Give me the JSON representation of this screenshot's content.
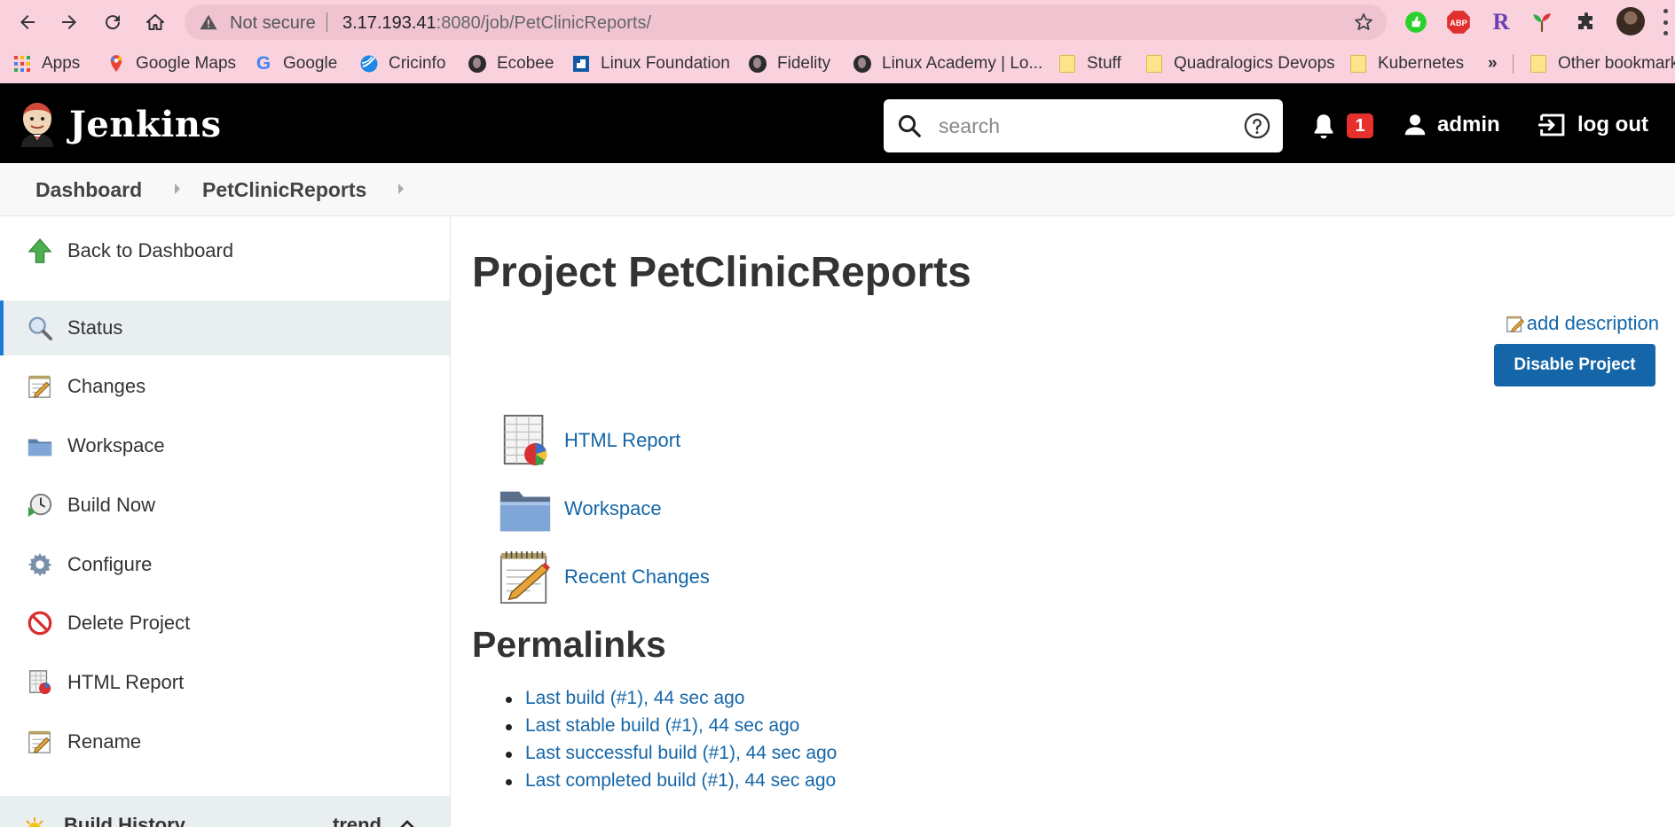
{
  "browser": {
    "not_secure": "Not secure",
    "url_host": "3.17.193.41",
    "url_path": ":8080/job/PetClinicReports/",
    "bookmarks": [
      {
        "label": "Apps",
        "icon": "apps-grid-icon"
      },
      {
        "label": "Google Maps",
        "icon": "google-maps-icon"
      },
      {
        "label": "Google",
        "icon": "google-icon"
      },
      {
        "label": "Cricinfo",
        "icon": "cricinfo-icon"
      },
      {
        "label": "Ecobee",
        "icon": "globe-icon"
      },
      {
        "label": "Linux Foundation",
        "icon": "linux-foundation-icon"
      },
      {
        "label": "Fidelity",
        "icon": "globe-icon"
      },
      {
        "label": "Linux Academy | Lo...",
        "icon": "globe-icon"
      },
      {
        "label": "Stuff",
        "icon": "folder-icon"
      },
      {
        "label": "Quadralogics Devops",
        "icon": "folder-icon"
      },
      {
        "label": "Kubernetes",
        "icon": "folder-icon"
      },
      {
        "label": "»",
        "icon": "overflow"
      },
      {
        "label": "Other bookmarks",
        "icon": "folder-icon"
      }
    ],
    "ext_abp": "ABP",
    "ext_r": "R"
  },
  "header": {
    "brand": "Jenkins",
    "search_placeholder": "search",
    "notification_count": "1",
    "username": "admin",
    "logout": "log out"
  },
  "breadcrumbs": [
    "Dashboard",
    "PetClinicReports"
  ],
  "sidebar": {
    "tasks": [
      {
        "label": "Back to Dashboard",
        "icon": "arrow-up-icon"
      },
      {
        "label": "Status",
        "icon": "magnifier-icon",
        "active": true
      },
      {
        "label": "Changes",
        "icon": "notepad-icon"
      },
      {
        "label": "Workspace",
        "icon": "folder-icon"
      },
      {
        "label": "Build Now",
        "icon": "clock-play-icon"
      },
      {
        "label": "Configure",
        "icon": "gear-icon"
      },
      {
        "label": "Delete Project",
        "icon": "no-entry-icon"
      },
      {
        "label": "HTML Report",
        "icon": "report-icon"
      },
      {
        "label": "Rename",
        "icon": "notepad-icon"
      }
    ],
    "build_history": {
      "title": "Build History",
      "trend": "trend"
    }
  },
  "main": {
    "title": "Project PetClinicReports",
    "add_description": "add description",
    "disable_button": "Disable Project",
    "links": [
      {
        "label": "HTML Report",
        "icon": "report-icon"
      },
      {
        "label": "Workspace",
        "icon": "folder-icon"
      },
      {
        "label": "Recent Changes",
        "icon": "notepad-icon"
      }
    ],
    "permalinks_title": "Permalinks",
    "permalinks": [
      "Last build (#1), 44 sec ago",
      "Last stable build (#1), 44 sec ago",
      "Last successful build (#1), 44 sec ago",
      "Last completed build (#1), 44 sec ago"
    ]
  },
  "colors": {
    "chrome": "#f9d2dd",
    "header": "#000000",
    "link": "#1566a8",
    "badge": "#e5302b",
    "active_accent": "#1d7bd6"
  }
}
